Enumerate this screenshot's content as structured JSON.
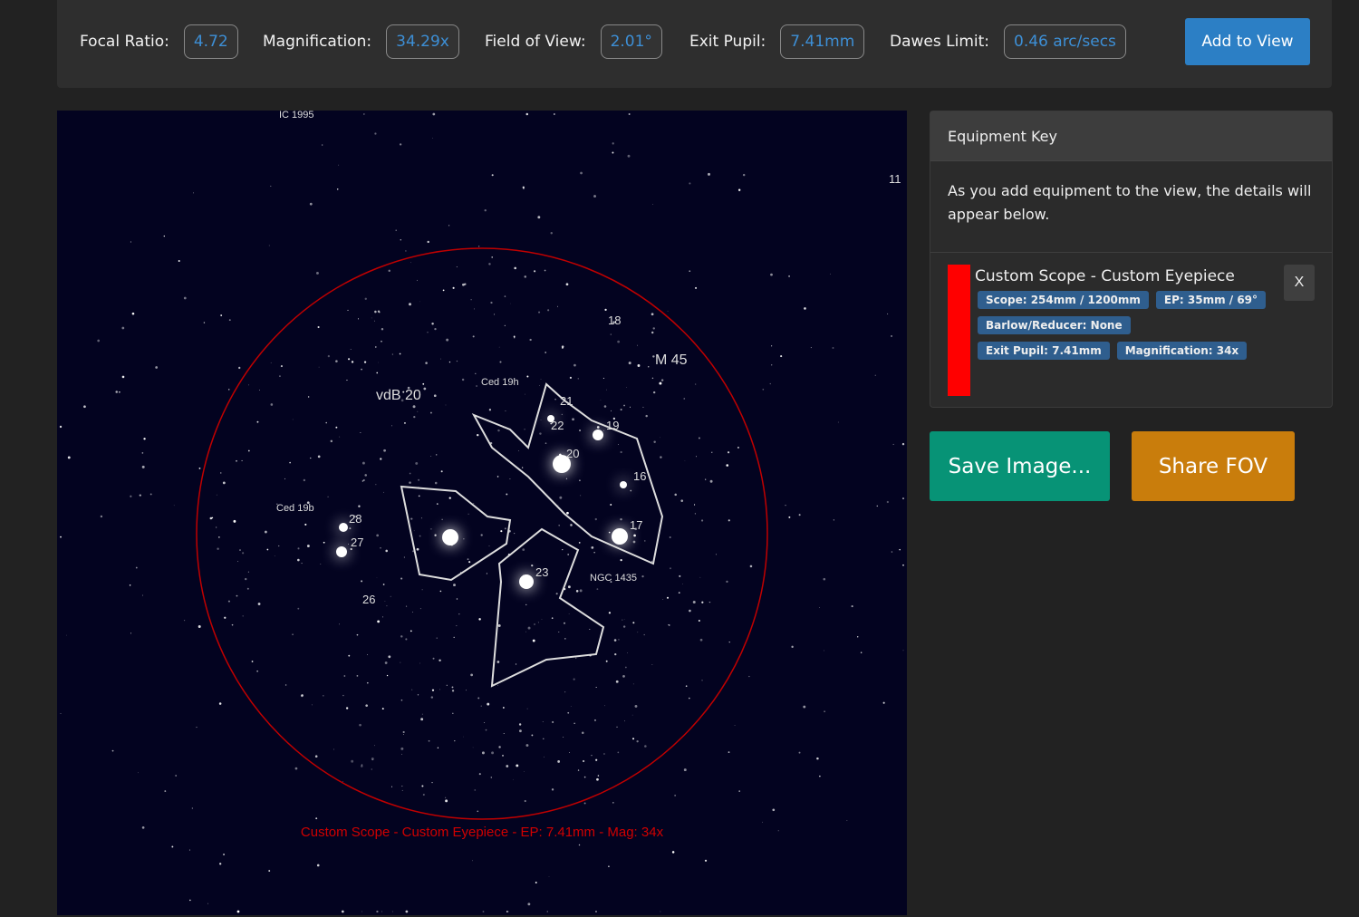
{
  "stats": [
    {
      "label": "Focal Ratio:",
      "value": "4.72"
    },
    {
      "label": "Magnification:",
      "value": "34.29x"
    },
    {
      "label": "Field of View:",
      "value": "2.01°"
    },
    {
      "label": "Exit Pupil:",
      "value": "7.41mm"
    },
    {
      "label": "Dawes Limit:",
      "value": "0.46 arc/secs"
    }
  ],
  "add_to_view": "Add to View",
  "fov_caption": "Custom Scope - Custom Eyepiece - EP: 7.41mm - Mag: 34x",
  "fov_color": "#d00000",
  "sky_labels": [
    "IC 1995",
    "11",
    "18",
    "M 45",
    "vdB 20",
    "Ced 19h",
    "21",
    "22",
    "19",
    "20",
    "16",
    "17",
    "Ced 19b",
    "28",
    "27",
    "23",
    "NGC 1435",
    "26"
  ],
  "equipment_key": {
    "title": "Equipment Key",
    "description": "As you add equipment to the view, the details will appear below.",
    "entry": {
      "color": "#ff0000",
      "title": "Custom Scope - Custom Eyepiece",
      "badges": [
        "Scope: 254mm / 1200mm",
        "EP: 35mm / 69°",
        "Barlow/Reducer: None",
        "Exit Pupil: 7.41mm",
        "Magnification: 34x"
      ],
      "remove": "X"
    }
  },
  "save_image": "Save Image...",
  "share_fov": "Share FOV",
  "colors": {
    "save": "#079376",
    "share": "#c97d0c",
    "accent": "#2c7fc5"
  }
}
